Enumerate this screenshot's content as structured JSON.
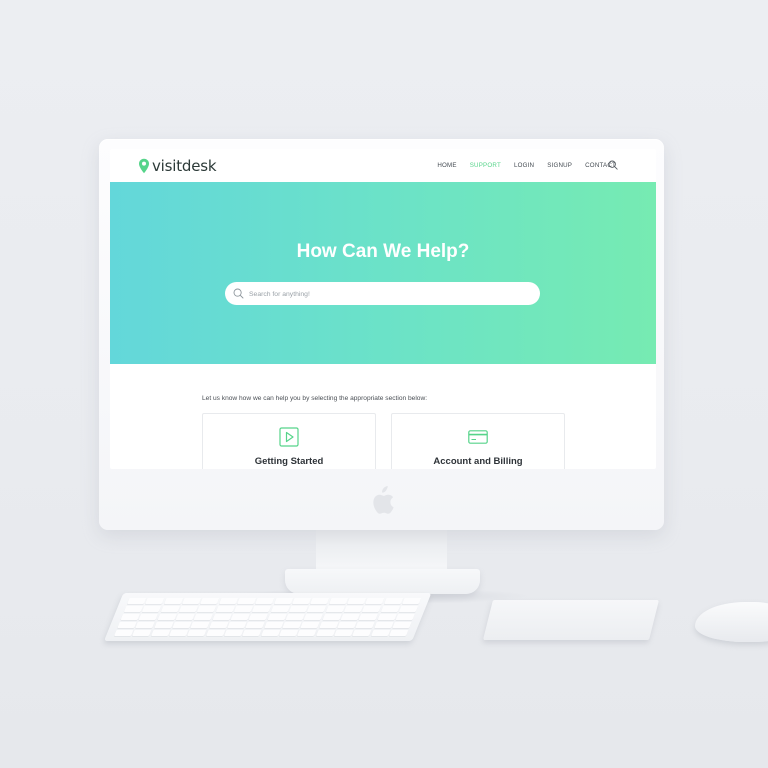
{
  "brand": {
    "name": "visitdesk",
    "accent_color": "#56d48a",
    "logo_icon": "map-pin-icon"
  },
  "nav": {
    "items": [
      {
        "label": "HOME",
        "active": false
      },
      {
        "label": "SUPPORT",
        "active": true
      },
      {
        "label": "LOGIN",
        "active": false
      },
      {
        "label": "SIGNUP",
        "active": false
      },
      {
        "label": "CONTACT",
        "active": false
      }
    ],
    "search_icon": "search-icon"
  },
  "hero": {
    "title": "How Can We Help?",
    "search_placeholder": "Search for anything!",
    "gradient": [
      "#63d7da",
      "#76ebb2"
    ]
  },
  "content": {
    "intro": "Let us know how we can help you by selecting the appropriate section below:",
    "cards": [
      {
        "title": "Getting Started",
        "icon": "play-icon"
      },
      {
        "title": "Account and Billing",
        "icon": "credit-card-icon"
      }
    ]
  },
  "device": {
    "logo_icon": "apple-logo-icon"
  }
}
